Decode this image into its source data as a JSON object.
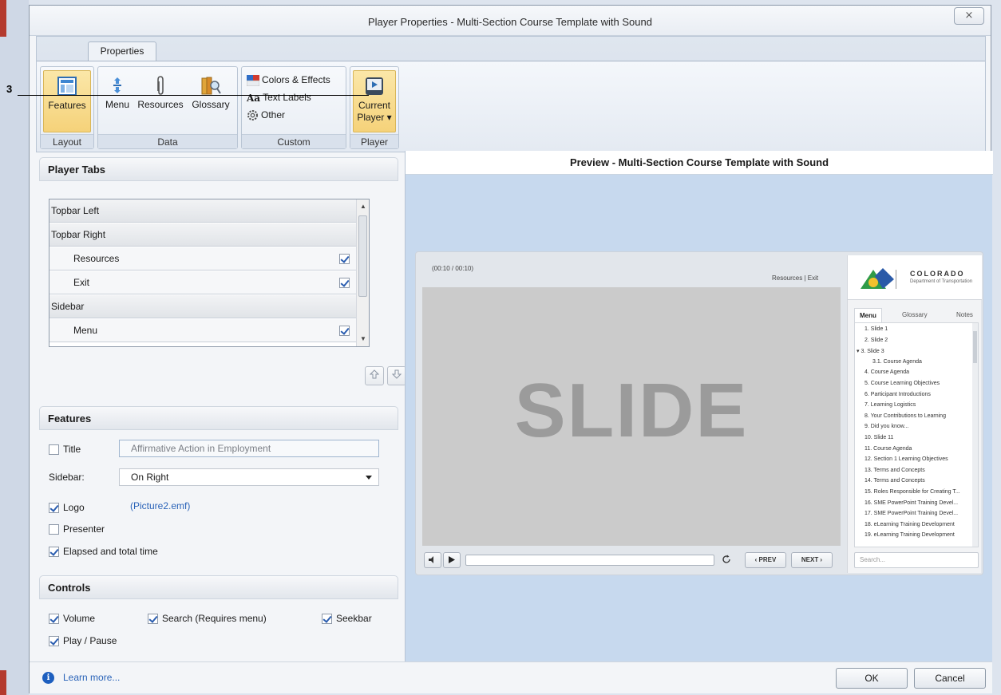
{
  "callout": {
    "number": "3"
  },
  "window": {
    "title": "Player Properties - Multi-Section Course Template with Sound",
    "close_glyph": "⨯"
  },
  "ribbon": {
    "tab": "Properties",
    "groups": {
      "layout": {
        "label": "Layout",
        "features": "Features"
      },
      "data": {
        "label": "Data",
        "menu": "Menu",
        "resources": "Resources",
        "glossary": "Glossary"
      },
      "custom": {
        "label": "Custom",
        "colors": "Colors & Effects",
        "text_labels": "Text Labels",
        "text_labels_glyph": "Aa",
        "other": "Other"
      },
      "player": {
        "label": "Player",
        "current_line1": "Current",
        "current_line2": "Player ▾"
      }
    }
  },
  "player_tabs": {
    "heading": "Player Tabs",
    "rows": [
      {
        "label": "Topbar Left",
        "type": "header"
      },
      {
        "label": "Topbar Right",
        "type": "header"
      },
      {
        "label": "Resources",
        "type": "child",
        "checked": true
      },
      {
        "label": "Exit",
        "type": "child",
        "checked": true
      },
      {
        "label": "Sidebar",
        "type": "header"
      },
      {
        "label": "Menu",
        "type": "child",
        "checked": true
      }
    ]
  },
  "features": {
    "heading": "Features",
    "title_label": "Title",
    "title_checked": false,
    "title_value": "Affirmative Action in Employment",
    "sidebar_label": "Sidebar:",
    "sidebar_value": "On Right",
    "logo_label": "Logo",
    "logo_checked": true,
    "logo_file": "(Picture2.emf)",
    "presenter_label": "Presenter",
    "presenter_checked": false,
    "elapsed_label": "Elapsed and total time",
    "elapsed_checked": true
  },
  "controls": {
    "heading": "Controls",
    "volume": "Volume",
    "search": "Search (Requires menu)",
    "seekbar": "Seekbar",
    "play_pause": "Play / Pause"
  },
  "preview": {
    "title": "Preview - Multi-Section Course Template with Sound",
    "time": "(00:10 / 00:10)",
    "top_links": "Resources  |  Exit",
    "slide_text": "SLIDE",
    "prev": "‹ PREV",
    "next": "NEXT ›",
    "logo_name": "COLORADO",
    "logo_sub": "Department of Transportation",
    "sidebar_tabs": [
      "Menu",
      "Glossary",
      "Notes"
    ],
    "menu_items": [
      "1. Slide 1",
      "2. Slide 2",
      "▾ 3. Slide 3",
      "3.1. Course Agenda",
      "4. Course Agenda",
      "5. Course Learning Objectives",
      "6. Participant Introductions",
      "7. Learning Logistics",
      "8. Your Contributions to Learning",
      "9. Did you know...",
      "10. Slide 11",
      "11. Course Agenda",
      "12. Section 1 Learning Objectives",
      "13. Terms and Concepts",
      "14. Terms and Concepts",
      "15. Roles Responsible for Creating T...",
      "16. SME PowerPoint Training Devel...",
      "17. SME PowerPoint Training Devel...",
      "18. eLearning Training Development",
      "19. eLearning Training Development"
    ],
    "search_placeholder": "Search..."
  },
  "footer": {
    "learn_more": "Learn more...",
    "ok": "OK",
    "cancel": "Cancel"
  }
}
